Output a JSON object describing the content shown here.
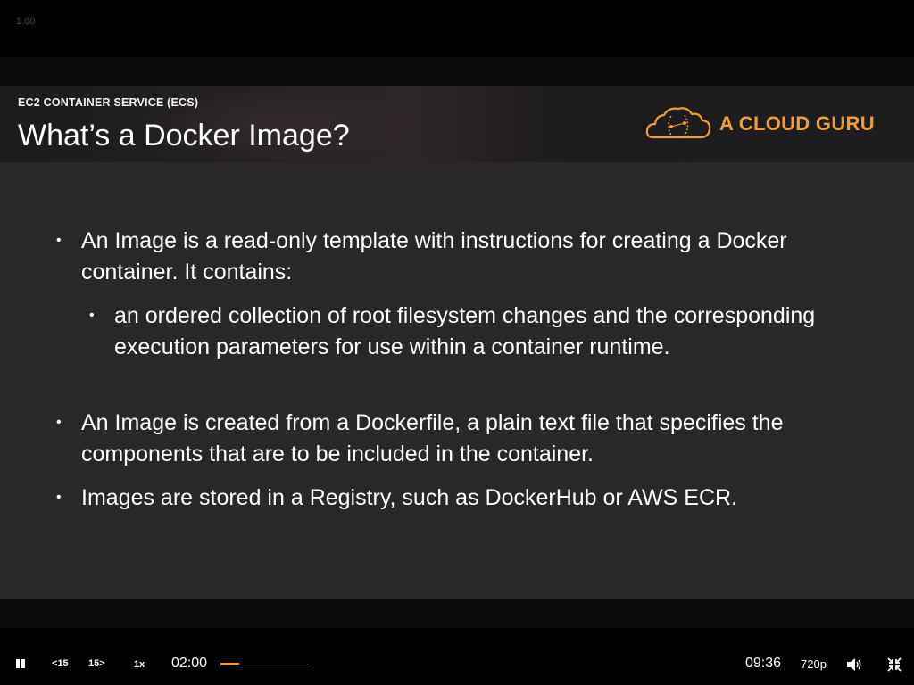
{
  "player": {
    "version_label": "1.00",
    "controls": {
      "pause_icon": "pause-icon",
      "rewind_label": "15",
      "forward_label": "15",
      "speed_label": "1x",
      "current_time": "02:00",
      "duration": "09:36",
      "progress_fraction": 0.21,
      "quality_label": "720p",
      "volume_icon": "volume-icon",
      "fullscreen_icon": "exit-fullscreen-icon"
    }
  },
  "slide": {
    "section_label": "EC2 CONTAINER SERVICE (ECS)",
    "title": "What’s a Docker Image?",
    "logo_text": "A CLOUD GURU",
    "brand_color": "#f39a3a",
    "bullets": [
      {
        "text": "An Image is a read-only template with instructions for creating a Docker container. It contains:",
        "sub_bullets": [
          "an ordered collection of root filesystem changes and the corresponding execution parameters for use within a container runtime."
        ]
      },
      {
        "text": "An Image is created from a Dockerfile, a plain text file that specifies the components that are to be included in the container.",
        "sub_bullets": []
      },
      {
        "text": "Images are stored in a Registry, such as DockerHub or AWS ECR.",
        "sub_bullets": []
      }
    ]
  }
}
